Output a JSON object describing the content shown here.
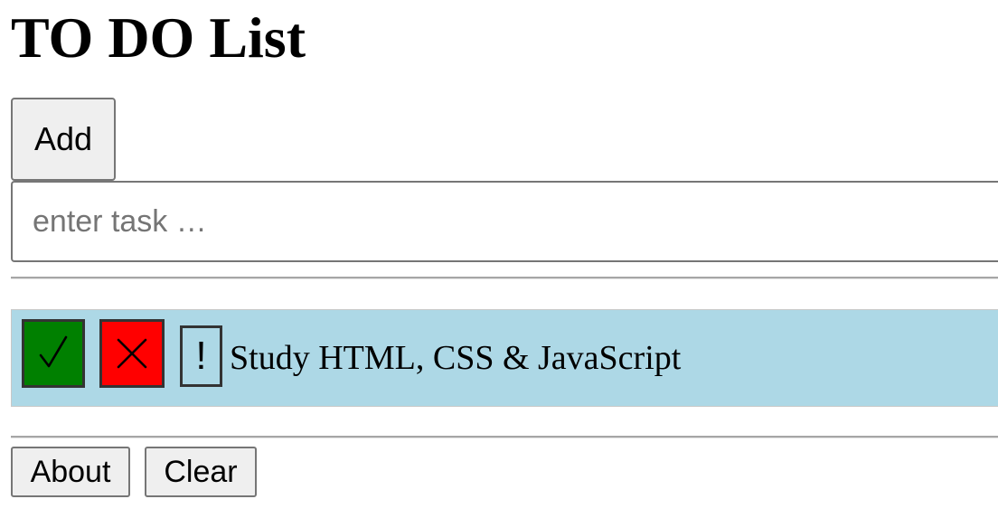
{
  "header": {
    "title": "TO DO List"
  },
  "task_entry": {
    "add_label": "Add",
    "input_value": "",
    "input_placeholder": "enter task …"
  },
  "tasks": [
    {
      "text": "Study HTML, CSS & JavaScript",
      "done_symbol": "✓",
      "delete_symbol": "✕",
      "priority_symbol": "!"
    }
  ],
  "footer": {
    "about_label": "About",
    "clear_label": "Clear"
  },
  "colors": {
    "task_background": "#add8e6",
    "done_button": "#008000",
    "delete_button": "#ff0000"
  },
  "icons": {
    "done": "check-icon",
    "delete": "cross-icon",
    "priority": "exclamation-icon"
  }
}
